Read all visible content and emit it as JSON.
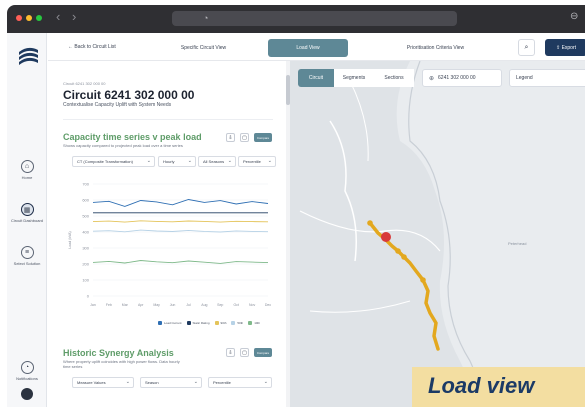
{
  "app": {
    "nav_back": "‹",
    "nav_forward": "›",
    "url_icon": "lock-icon"
  },
  "sidebar": {
    "items": [
      {
        "label": "Home",
        "icon": "home-icon"
      },
      {
        "label": "Circuit Dashboard",
        "icon": "dashboard-icon"
      },
      {
        "label": "Select Solution",
        "icon": "list-icon"
      },
      {
        "label": "Notifications",
        "icon": "bell-icon"
      },
      {
        "label": "Profile",
        "icon": "user-icon"
      }
    ]
  },
  "topnav": {
    "back_label": "←  Back to Circuit List",
    "tabs": [
      "Specific Circuit View",
      "Load View",
      "Prioritisation Criteria View"
    ],
    "active_tab": "Load View",
    "export_label": "⇪  Export"
  },
  "circuit": {
    "crumb": "Circuit 6241 302 000 00",
    "title": "Circuit 6241 302 000 00",
    "subtitle": "Contextualise Capacity Uplift with System Needs"
  },
  "capacity_section": {
    "title": "Capacity time series v peak load",
    "subtitle": "Shows capacity compared to projected peak load over a time series",
    "compare_label": "Compare",
    "filters": [
      "CT (Composite Transformation)",
      "Hourly",
      "All Seasons",
      "Percentile"
    ]
  },
  "synergy_section": {
    "title": "Historic Synergy Analysis",
    "subtitle": "Where property uplift coincides with high power flows. Data hourly time series",
    "compare_label": "Compare",
    "filters": [
      "Measure Values",
      "Season",
      "Percentile"
    ]
  },
  "chart_data": {
    "type": "line",
    "x": [
      "Jan",
      "Feb",
      "Mar",
      "Apr",
      "May",
      "Jun",
      "Jul",
      "Aug",
      "Sep",
      "Oct",
      "Nov",
      "Dec"
    ],
    "ylabel": "Load (kVA)",
    "yticks": [
      "700",
      "600",
      "500",
      "400",
      "300",
      "200",
      "100",
      "0"
    ],
    "ylim": [
      0,
      700
    ],
    "series": [
      {
        "name": "Load Current",
        "color": "#2f6fb3",
        "values": [
          585,
          592,
          560,
          597,
          588,
          570,
          603,
          585,
          596,
          575,
          590,
          578
        ]
      },
      {
        "name": "Static Rating",
        "color": "#1f3a5f",
        "values": [
          520,
          520,
          520,
          520,
          520,
          520,
          520,
          520,
          520,
          520,
          520,
          520
        ]
      },
      {
        "name": "90th",
        "color": "#e4c45a",
        "values": [
          465,
          468,
          462,
          470,
          466,
          464,
          469,
          466,
          462,
          467,
          465,
          464
        ]
      },
      {
        "name": "50th",
        "color": "#b7d2e6",
        "values": [
          405,
          408,
          401,
          412,
          406,
          403,
          410,
          404,
          400,
          407,
          404,
          402
        ]
      },
      {
        "name": "10th",
        "color": "#7fb98a",
        "values": [
          210,
          216,
          206,
          222,
          214,
          208,
          219,
          211,
          204,
          215,
          212,
          209
        ]
      }
    ],
    "legend_position": "bottom-right",
    "grid": true
  },
  "map": {
    "tabs": [
      "Circuit",
      "Segments",
      "Sections"
    ],
    "active_tab": "Circuit",
    "selected_circuit": "6241 302 000 00",
    "legend_label": "Legend",
    "place_label": "Peterhead",
    "route_color": "#e3a81f",
    "alert_color": "#d83a3a"
  },
  "caption": {
    "text": "Load view"
  }
}
